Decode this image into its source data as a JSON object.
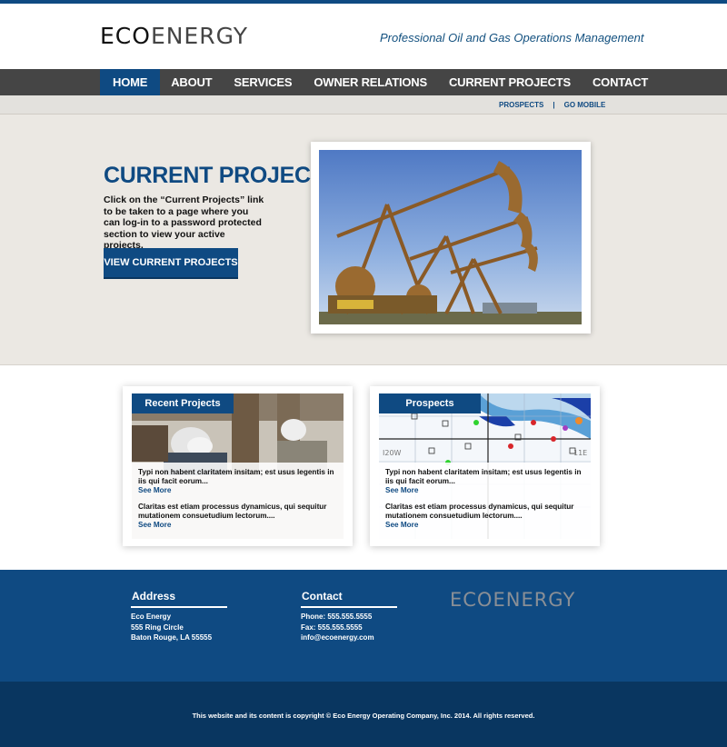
{
  "brand": {
    "logo_part1": "ECO",
    "logo_part2": "ENERGY",
    "tagline": "Professional Oil and Gas Operations Management"
  },
  "nav": {
    "items": [
      {
        "label": "HOME",
        "active": true
      },
      {
        "label": "ABOUT"
      },
      {
        "label": "SERVICES"
      },
      {
        "label": "OWNER RELATIONS"
      },
      {
        "label": "CURRENT PROJECTS"
      },
      {
        "label": "CONTACT"
      }
    ]
  },
  "subnav": {
    "prospects": "PROSPECTS",
    "separator": "|",
    "go_mobile": "GO MOBILE"
  },
  "hero": {
    "title": "CURRENT PROJECTS",
    "text": "Click on the “Current Projects” link to be taken to a page where you can log-in to a password protected section to view your active projects.",
    "button": "VIEW CURRENT PROJECTS"
  },
  "cards": [
    {
      "label": "Recent Projects",
      "items": [
        {
          "desc": "Typi non habent claritatem insitam; est usus legentis in iis qui facit eorum...",
          "more": "See More"
        },
        {
          "desc": "Claritas est etiam processus dynamicus, qui sequitur mutationem consuetudium lectorum....",
          "more": "See More"
        }
      ]
    },
    {
      "label": "Prospects",
      "items": [
        {
          "desc": "Typi non habent claritatem insitam; est usus legentis in iis qui facit eorum...",
          "more": "See More"
        },
        {
          "desc": "Claritas est etiam processus dynamicus, qui sequitur mutationem consuetudium lectorum....",
          "more": "See More"
        }
      ],
      "map_labels": [
        "I20W",
        "11E"
      ]
    }
  ],
  "footer": {
    "address": {
      "heading": "Address",
      "lines": [
        "Eco Energy",
        "555 Ring Circle",
        "Baton Rouge, LA 55555"
      ]
    },
    "contact": {
      "heading": "Contact",
      "lines": [
        "Phone: 555.555.5555",
        "Fax: 555.555.5555",
        "info@ecoenergy.com"
      ]
    },
    "logo": "ECOENERGY",
    "copyright": "This website and its content is copyright © Eco Energy Operating Company, Inc. 2014. All rights reserved."
  },
  "colors": {
    "brand_blue": "#0f4a82",
    "nav_gray": "#454545",
    "hero_bg": "#ebe8e3",
    "bottom_blue": "#093660"
  }
}
